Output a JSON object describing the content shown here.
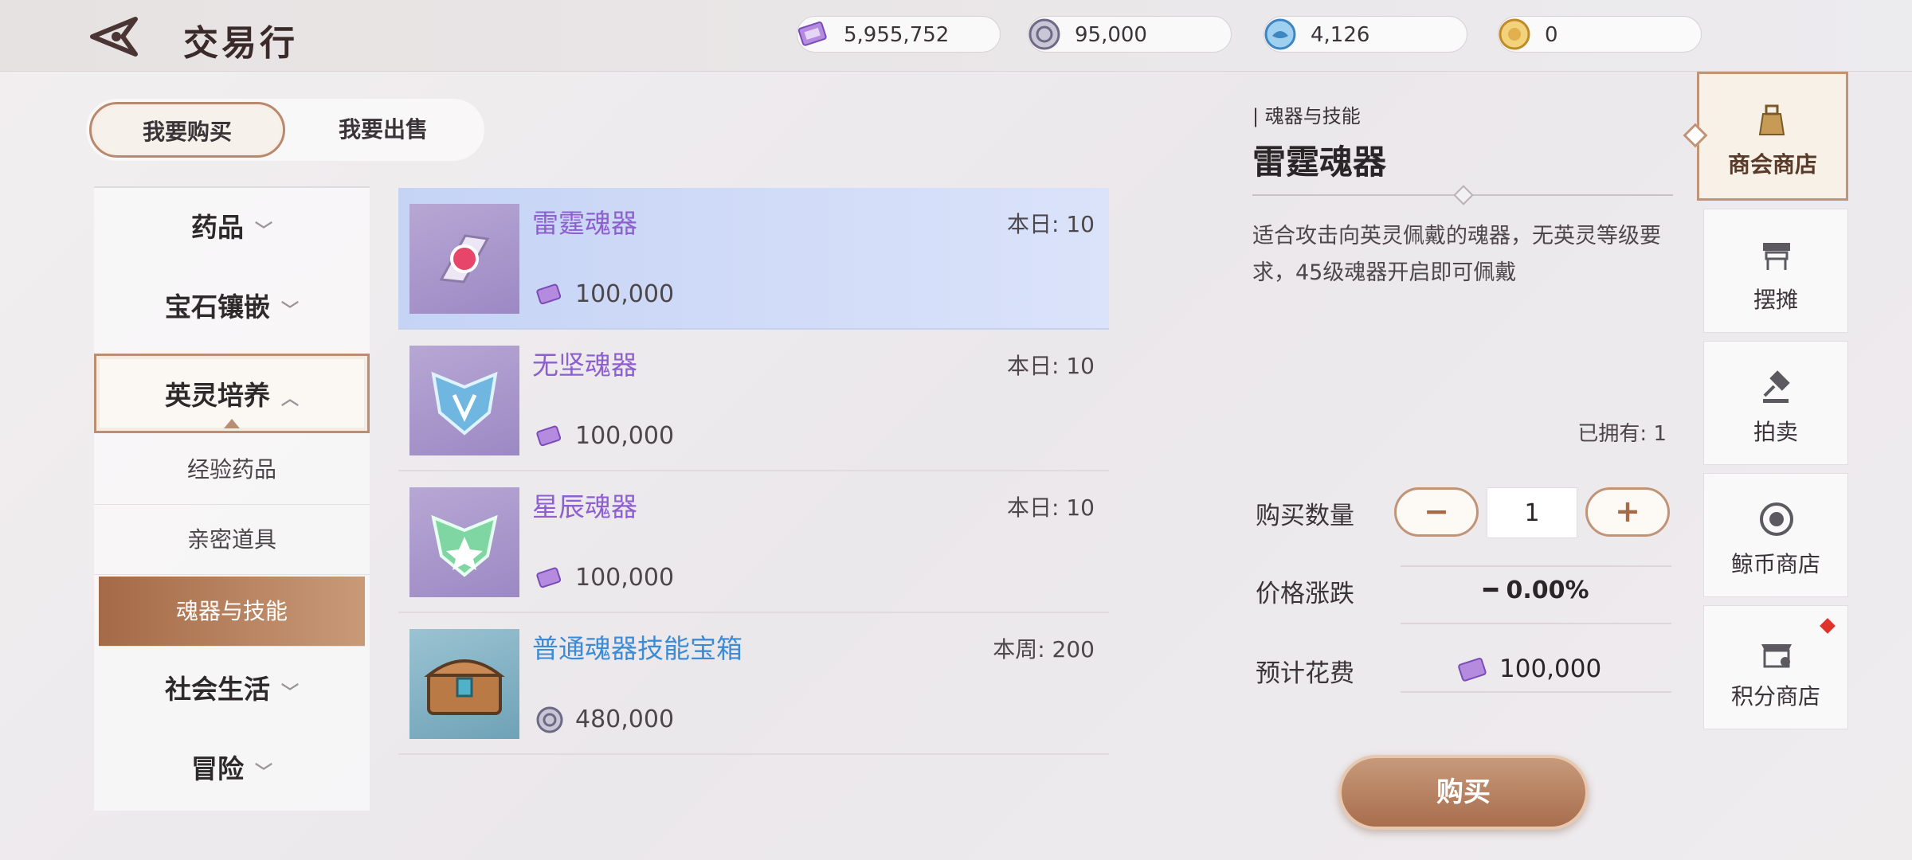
{
  "header": {
    "title": "交易行",
    "currencies": [
      {
        "icon": "purple-ticket-icon",
        "value": "5,955,752"
      },
      {
        "icon": "silver-coin-icon",
        "value": "95,000"
      },
      {
        "icon": "blue-whale-coin-icon",
        "value": "4,126"
      },
      {
        "icon": "gold-coin-icon",
        "value": "0"
      }
    ]
  },
  "tabs": {
    "buy": "我要购买",
    "sell": "我要出售"
  },
  "categories": {
    "medicine": "药品",
    "gems": "宝石镶嵌",
    "spirit": "英灵培养",
    "sub_exp": "经验药品",
    "sub_intimacy": "亲密道具",
    "sub_soul": "魂器与技能",
    "social": "社会生活",
    "adventure": "冒险"
  },
  "items": [
    {
      "name": "雷霆魂器",
      "limit": "本日: 10",
      "price": "100,000",
      "currency": "purple-ticket-icon"
    },
    {
      "name": "无坚魂器",
      "limit": "本日: 10",
      "price": "100,000",
      "currency": "purple-ticket-icon"
    },
    {
      "name": "星辰魂器",
      "limit": "本日: 10",
      "price": "100,000",
      "currency": "purple-ticket-icon"
    },
    {
      "name": "普通魂器技能宝箱",
      "limit": "本周:  200",
      "price": "480,000",
      "currency": "silver-coin-icon"
    }
  ],
  "detail": {
    "category": "| 魂器与技能",
    "title": "雷霆魂器",
    "description": "适合攻击向英灵佩戴的魂器，无英灵等级要求，45级魂器开启即可佩戴",
    "owned": "已拥有: 1",
    "qty_label": "购买数量",
    "qty_minus": "−",
    "qty_value": "1",
    "qty_plus": "+",
    "change_label": "价格涨跌",
    "change_value": "━ 0.00%",
    "cost_label": "预计花费",
    "cost_value": "100,000",
    "buy_label": "购买"
  },
  "right_nav": [
    {
      "label": "商会商店",
      "icon": "merchant-bag-icon",
      "active": true
    },
    {
      "label": "摆摊",
      "icon": "stall-icon",
      "active": false
    },
    {
      "label": "拍卖",
      "icon": "gavel-icon",
      "active": false
    },
    {
      "label": "鲸币商店",
      "icon": "whale-coin-icon",
      "active": false
    },
    {
      "label": "积分商店",
      "icon": "shop-icon",
      "active": false,
      "badge": true
    }
  ],
  "colors": {
    "accent": "#a56a47",
    "purple_name": "#8d5fd0",
    "blue_name": "#3b8bd6",
    "selected_row": "#c5d3f5"
  }
}
